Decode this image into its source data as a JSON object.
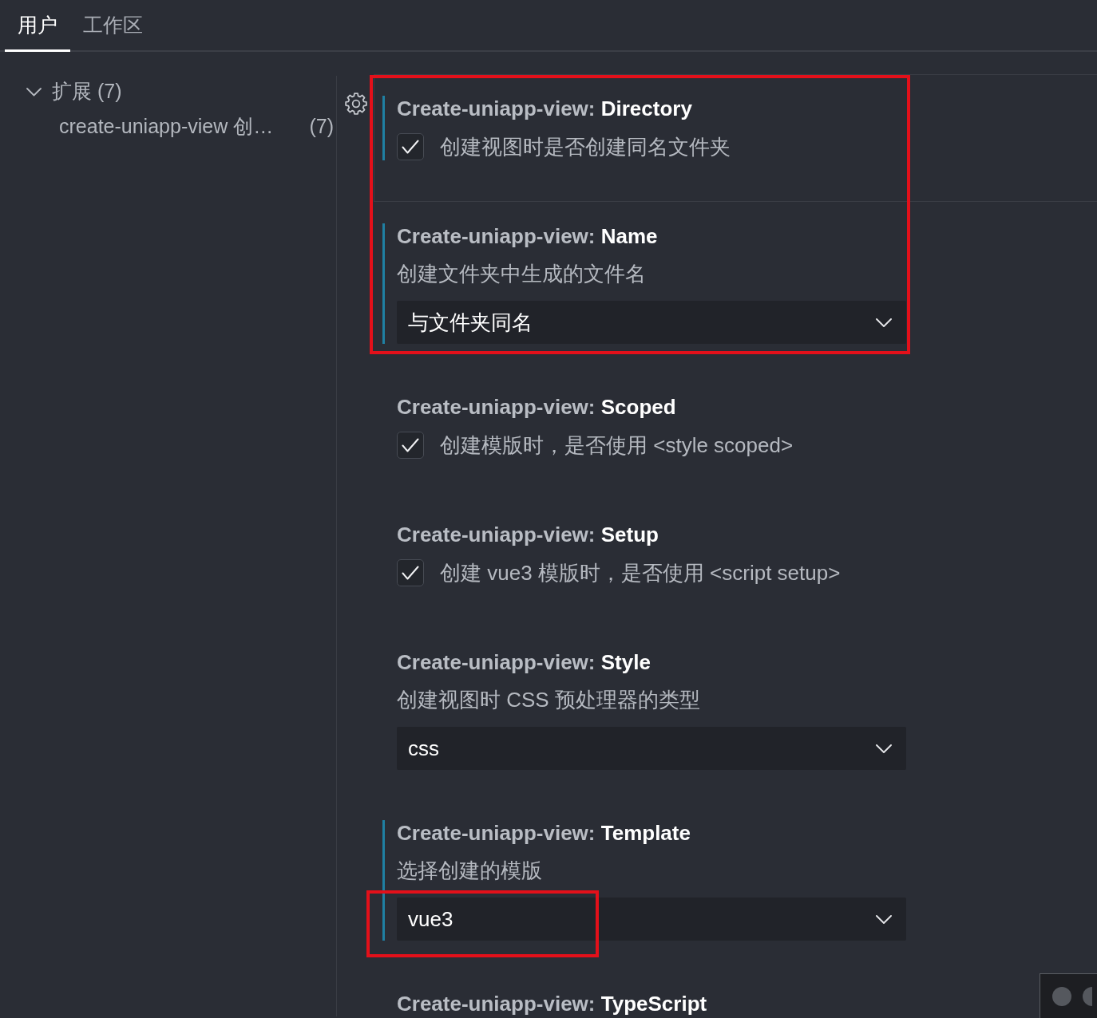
{
  "tabs": [
    {
      "label": "用户",
      "selected": true
    },
    {
      "label": "工作区",
      "selected": false
    }
  ],
  "tree": [
    {
      "label": "扩展 (7)",
      "expanded": true,
      "children": [
        {
          "label": "create-uniapp-view 创…",
          "count": "(7)"
        }
      ]
    }
  ],
  "settings": [
    {
      "category": "Create-uniapp-view:",
      "name": "Directory",
      "kind": "checkbox",
      "description": "创建视图时是否创建同名文件夹",
      "checked": true,
      "modified": true,
      "focused": true,
      "highlighted": true
    },
    {
      "category": "Create-uniapp-view:",
      "name": "Name",
      "kind": "dropdown",
      "description": "创建文件夹中生成的文件名",
      "value": "与文件夹同名",
      "modified": true,
      "focused": false,
      "highlighted": true,
      "value_highlighted": false
    },
    {
      "category": "Create-uniapp-view:",
      "name": "Scoped",
      "kind": "checkbox",
      "description": "创建模版时，是否使用 <style scoped>",
      "checked": true,
      "modified": false,
      "focused": false,
      "highlighted": false
    },
    {
      "category": "Create-uniapp-view:",
      "name": "Setup",
      "kind": "checkbox",
      "description": "创建 vue3 模版时，是否使用 <script setup>",
      "checked": true,
      "modified": false,
      "focused": false,
      "highlighted": false
    },
    {
      "category": "Create-uniapp-view:",
      "name": "Style",
      "kind": "dropdown",
      "description": "创建视图时 CSS 预处理器的类型",
      "value": "css",
      "modified": false,
      "focused": false,
      "highlighted": false,
      "value_highlighted": false
    },
    {
      "category": "Create-uniapp-view:",
      "name": "Template",
      "kind": "dropdown",
      "description": "选择创建的模版",
      "value": "vue3",
      "modified": true,
      "focused": false,
      "highlighted": false,
      "value_highlighted": true
    },
    {
      "category": "Create-uniapp-view:",
      "name": "TypeScript",
      "modified": false,
      "focused": false,
      "highlighted": false
    }
  ]
}
